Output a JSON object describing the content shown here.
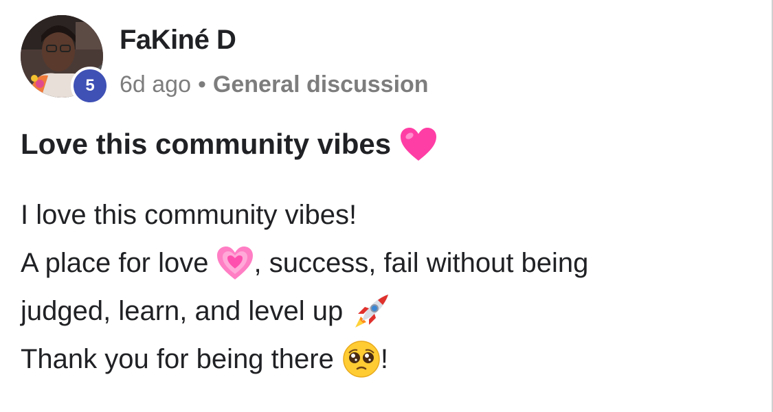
{
  "post": {
    "author": "FaKiné D",
    "level": "5",
    "time": "6d ago",
    "separator": "•",
    "category": "General discussion",
    "title": "Love this community vibes",
    "body": {
      "line1": "I love this community vibes!",
      "line2_a": "A place for love",
      "line2_b": ", success, fail without being",
      "line3": "judged, learn, and level up",
      "line4_a": "Thank you for being there",
      "line4_b": "!"
    }
  },
  "icons": {
    "title_emoji": "pink-heart-icon",
    "love_emoji": "growing-heart-icon",
    "level_up_emoji": "rocket-icon",
    "thanks_emoji": "pleading-face-icon"
  },
  "colors": {
    "level_badge": "#3f51b5",
    "meta_text": "#7d7d7d",
    "text": "#202124",
    "heart": "#ff3ea5"
  }
}
